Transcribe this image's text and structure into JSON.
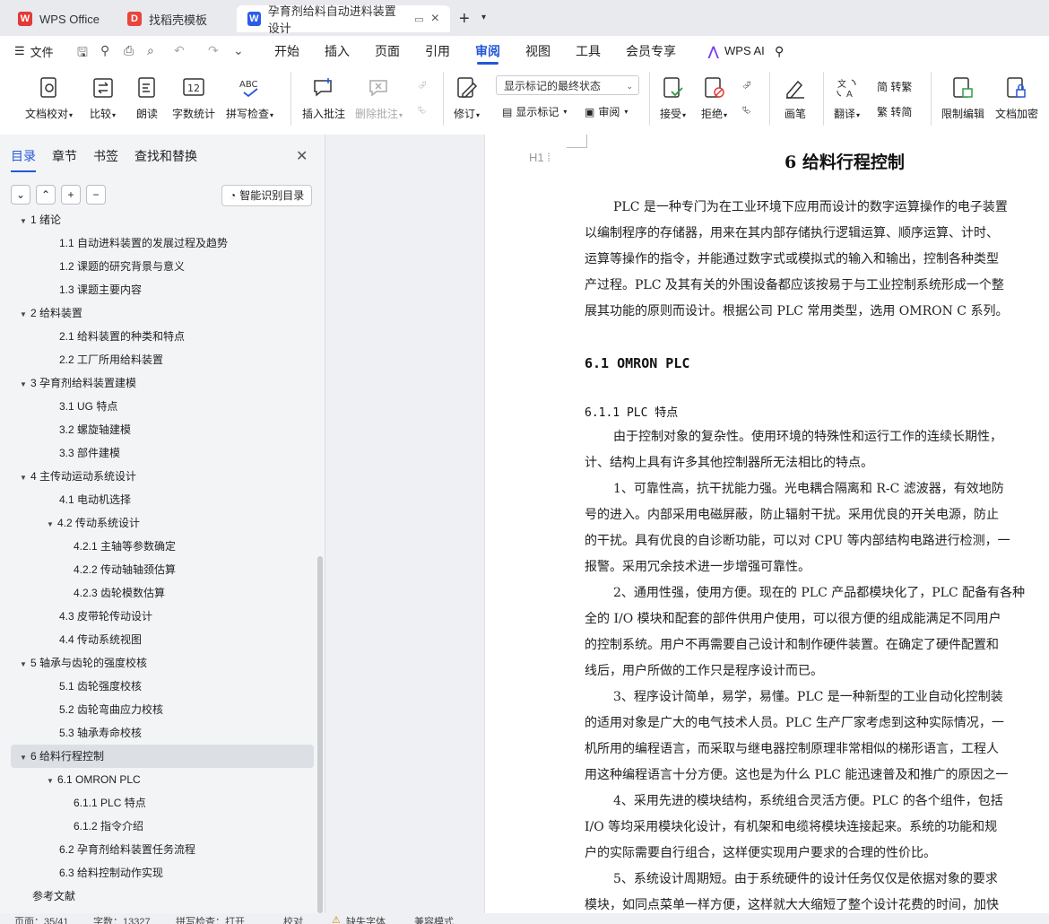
{
  "tabs": [
    {
      "label": "WPS Office",
      "icon": "wps-logo-icon"
    },
    {
      "label": "找稻壳模板",
      "icon": "docer-icon"
    },
    {
      "label": "孕育剂给料自动进料装置设计",
      "icon": "word-doc-icon"
    }
  ],
  "menubar": {
    "file": "文件",
    "items": [
      "开始",
      "插入",
      "页面",
      "引用",
      "审阅",
      "视图",
      "工具",
      "会员专享"
    ],
    "active": "审阅",
    "wps_ai": "WPS AI"
  },
  "ribbon": {
    "buttons": [
      "文档校对",
      "比较",
      "朗读",
      "字数统计",
      "拼写检查",
      "插入批注",
      "删除批注",
      "修订",
      "接受",
      "拒绝",
      "画笔",
      "翻译",
      "限制编辑",
      "文档加密"
    ],
    "markup_select": "显示标记的最终状态",
    "show_markup": "显示标记",
    "review": "审阅",
    "to_traditional": "简 转繁",
    "to_simplified": "繁 转简"
  },
  "nav": {
    "tabs": [
      "目录",
      "章节",
      "书签",
      "查找和替换"
    ],
    "active_tab": "目录",
    "smart_toc": "智能识别目录",
    "toc": [
      {
        "text": "1   绪论",
        "level": 1,
        "arrow": true
      },
      {
        "text": "1.1 自动进料装置的发展过程及趋势",
        "level": 2
      },
      {
        "text": "1.2 课题的研究背景与意义",
        "level": 2
      },
      {
        "text": "1.3 课题主要内容",
        "level": 2
      },
      {
        "text": "2   给料装置",
        "level": 1,
        "arrow": true
      },
      {
        "text": "2.1 给料装置的种类和特点",
        "level": 2
      },
      {
        "text": "2.2 工厂所用给料装置",
        "level": 2
      },
      {
        "text": "3  孕育剂给料装置建模",
        "level": 1,
        "arrow": true
      },
      {
        "text": "3.1 UG 特点",
        "level": 2
      },
      {
        "text": "3.2 螺旋轴建模",
        "level": 2
      },
      {
        "text": "3.3 部件建模",
        "level": 2
      },
      {
        "text": "4   主传动运动系统设计",
        "level": 1,
        "arrow": true
      },
      {
        "text": "4.1 电动机选择",
        "level": 2
      },
      {
        "text": "4.2 传动系统设计",
        "level": 2,
        "arrow": true
      },
      {
        "text": "4.2.1 主轴等参数确定",
        "level": 3
      },
      {
        "text": "4.2.2 传动轴轴颈估算",
        "level": 3
      },
      {
        "text": "4.2.3 齿轮模数估算",
        "level": 3
      },
      {
        "text": "4.3 皮带轮传动设计",
        "level": 2
      },
      {
        "text": "4.4 传动系统视图",
        "level": 2
      },
      {
        "text": "5   轴承与齿轮的强度校核",
        "level": 1,
        "arrow": true
      },
      {
        "text": "5.1 齿轮强度校核",
        "level": 2
      },
      {
        "text": "5.2 齿轮弯曲应力校核",
        "level": 2
      },
      {
        "text": "5.3 轴承寿命校核",
        "level": 2
      },
      {
        "text": "6   给料行程控制",
        "level": 1,
        "arrow": true,
        "selected": true
      },
      {
        "text": "6.1 OMRON PLC",
        "level": 2,
        "arrow": true
      },
      {
        "text": "6.1.1 PLC 特点",
        "level": 3
      },
      {
        "text": "6.1.2 指令介绍",
        "level": 3
      },
      {
        "text": "6.2 孕育剂给料装置任务流程",
        "level": 2
      },
      {
        "text": "6.3 给料控制动作实现",
        "level": 2
      },
      {
        "text": "参考文献",
        "level": 1
      }
    ]
  },
  "document": {
    "heading1": "6   给料行程控制",
    "heading_marker": "H1",
    "intro_lines": [
      "PLC 是一种专门为在工业环境下应用而设计的数字运算操作的电子装置",
      "以编制程序的存储器，用来在其内部存储执行逻辑运算、顺序运算、计时、",
      "运算等操作的指令，并能通过数字式或模拟式的输入和输出，控制各种类型",
      "产过程。PLC 及其有关的外围设备都应该按易于与工业控制系统形成一个整",
      "展其功能的原则而设计。根据公司 PLC 常用类型，选用 OMRON C 系列。"
    ],
    "heading2": "6.1 OMRON PLC",
    "heading3": "6.1.1 PLC 特点",
    "body_lines": [
      "由于控制对象的复杂性。使用环境的特殊性和运行工作的连续长期性，",
      "计、结构上具有许多其他控制器所无法相比的特点。",
      "1、可靠性高，抗干扰能力强。光电耦合隔离和 R-C 滤波器，有效地防",
      "号的进入。内部采用电磁屏蔽，防止辐射干扰。采用优良的开关电源，防止",
      "的干扰。具有优良的自诊断功能，可以对 CPU 等内部结构电路进行检测，一",
      "报警。采用冗余技术进一步增强可靠性。",
      "2、通用性强，使用方便。现在的 PLC 产品都模块化了，PLC 配备有各种",
      "全的 I/O 模块和配套的部件供用户使用，可以很方便的组成能满足不同用户",
      "的控制系统。用户不再需要自己设计和制作硬件装置。在确定了硬件配置和",
      "线后，用户所做的工作只是程序设计而已。",
      "3、程序设计简单，易学，易懂。PLC 是一种新型的工业自动化控制装",
      "的适用对象是广大的电气技术人员。PLC 生产厂家考虑到这种实际情况，一",
      "机所用的编程语言，而采取与继电器控制原理非常相似的梯形语言，工程人",
      "用这种编程语言十分方便。这也是为什么 PLC 能迅速普及和推广的原因之一",
      "4、采用先进的模块结构，系统组合灵活方便。PLC 的各个组件，包括",
      "I/O 等均采用模块化设计，有机架和电缆将模块连接起来。系统的功能和规",
      "户的实际需要自行组合，这样便实现用户要求的合理的性价比。",
      "5、系统设计周期短。由于系统硬件的设计任务仅仅是依据对象的要求",
      "模块，如同点菜单一样方便，这样就大大缩短了整个设计花费的时间，加快"
    ]
  },
  "statusbar": {
    "page": "页面：35/41",
    "words": "字数：13327",
    "spell": "拼写检查：打开",
    "proof": "校对",
    "missing_font": "缺失字体",
    "compat": "兼容模式"
  }
}
